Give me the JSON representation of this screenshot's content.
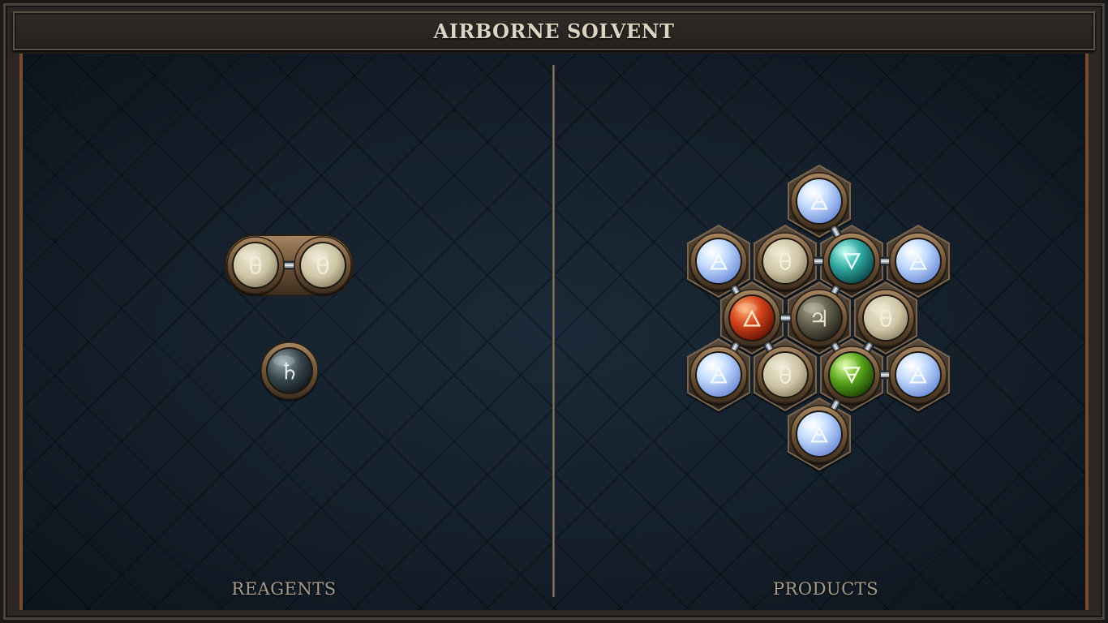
{
  "title": "AIRBORNE SOLVENT",
  "panels": {
    "reagents_label": "REAGENTS",
    "products_label": "PRODUCTS"
  },
  "reagents": {
    "molecules": [
      {
        "atoms": [
          {
            "element": "salt",
            "symbol": "θ"
          },
          {
            "element": "salt",
            "symbol": "θ"
          }
        ],
        "bonds": 1
      },
      {
        "atoms": [
          {
            "element": "lead",
            "symbol": "♄"
          }
        ],
        "bonds": 0
      }
    ]
  },
  "products": {
    "atoms": [
      {
        "element": "air",
        "symbol": "🜁"
      },
      {
        "element": "air",
        "symbol": "🜁"
      },
      {
        "element": "salt",
        "symbol": "θ"
      },
      {
        "element": "water",
        "symbol": "🜄"
      },
      {
        "element": "air",
        "symbol": "🜁"
      },
      {
        "element": "fire",
        "symbol": "🜂"
      },
      {
        "element": "tin",
        "symbol": "♃"
      },
      {
        "element": "salt",
        "symbol": "θ"
      },
      {
        "element": "air",
        "symbol": "🜁"
      },
      {
        "element": "salt",
        "symbol": "θ"
      },
      {
        "element": "earth",
        "symbol": "🜃"
      },
      {
        "element": "air",
        "symbol": "🜁"
      },
      {
        "element": "air",
        "symbol": "🜁"
      }
    ]
  },
  "colors": {
    "salt": "#d8cfb4",
    "air": "#b9d6ff",
    "water": "#2fa7a0",
    "fire": "#d2421a",
    "earth": "#5aa61c",
    "tin": "#5c5a48",
    "lead": "#36464c",
    "frame_bronze": "#8a6a48"
  }
}
